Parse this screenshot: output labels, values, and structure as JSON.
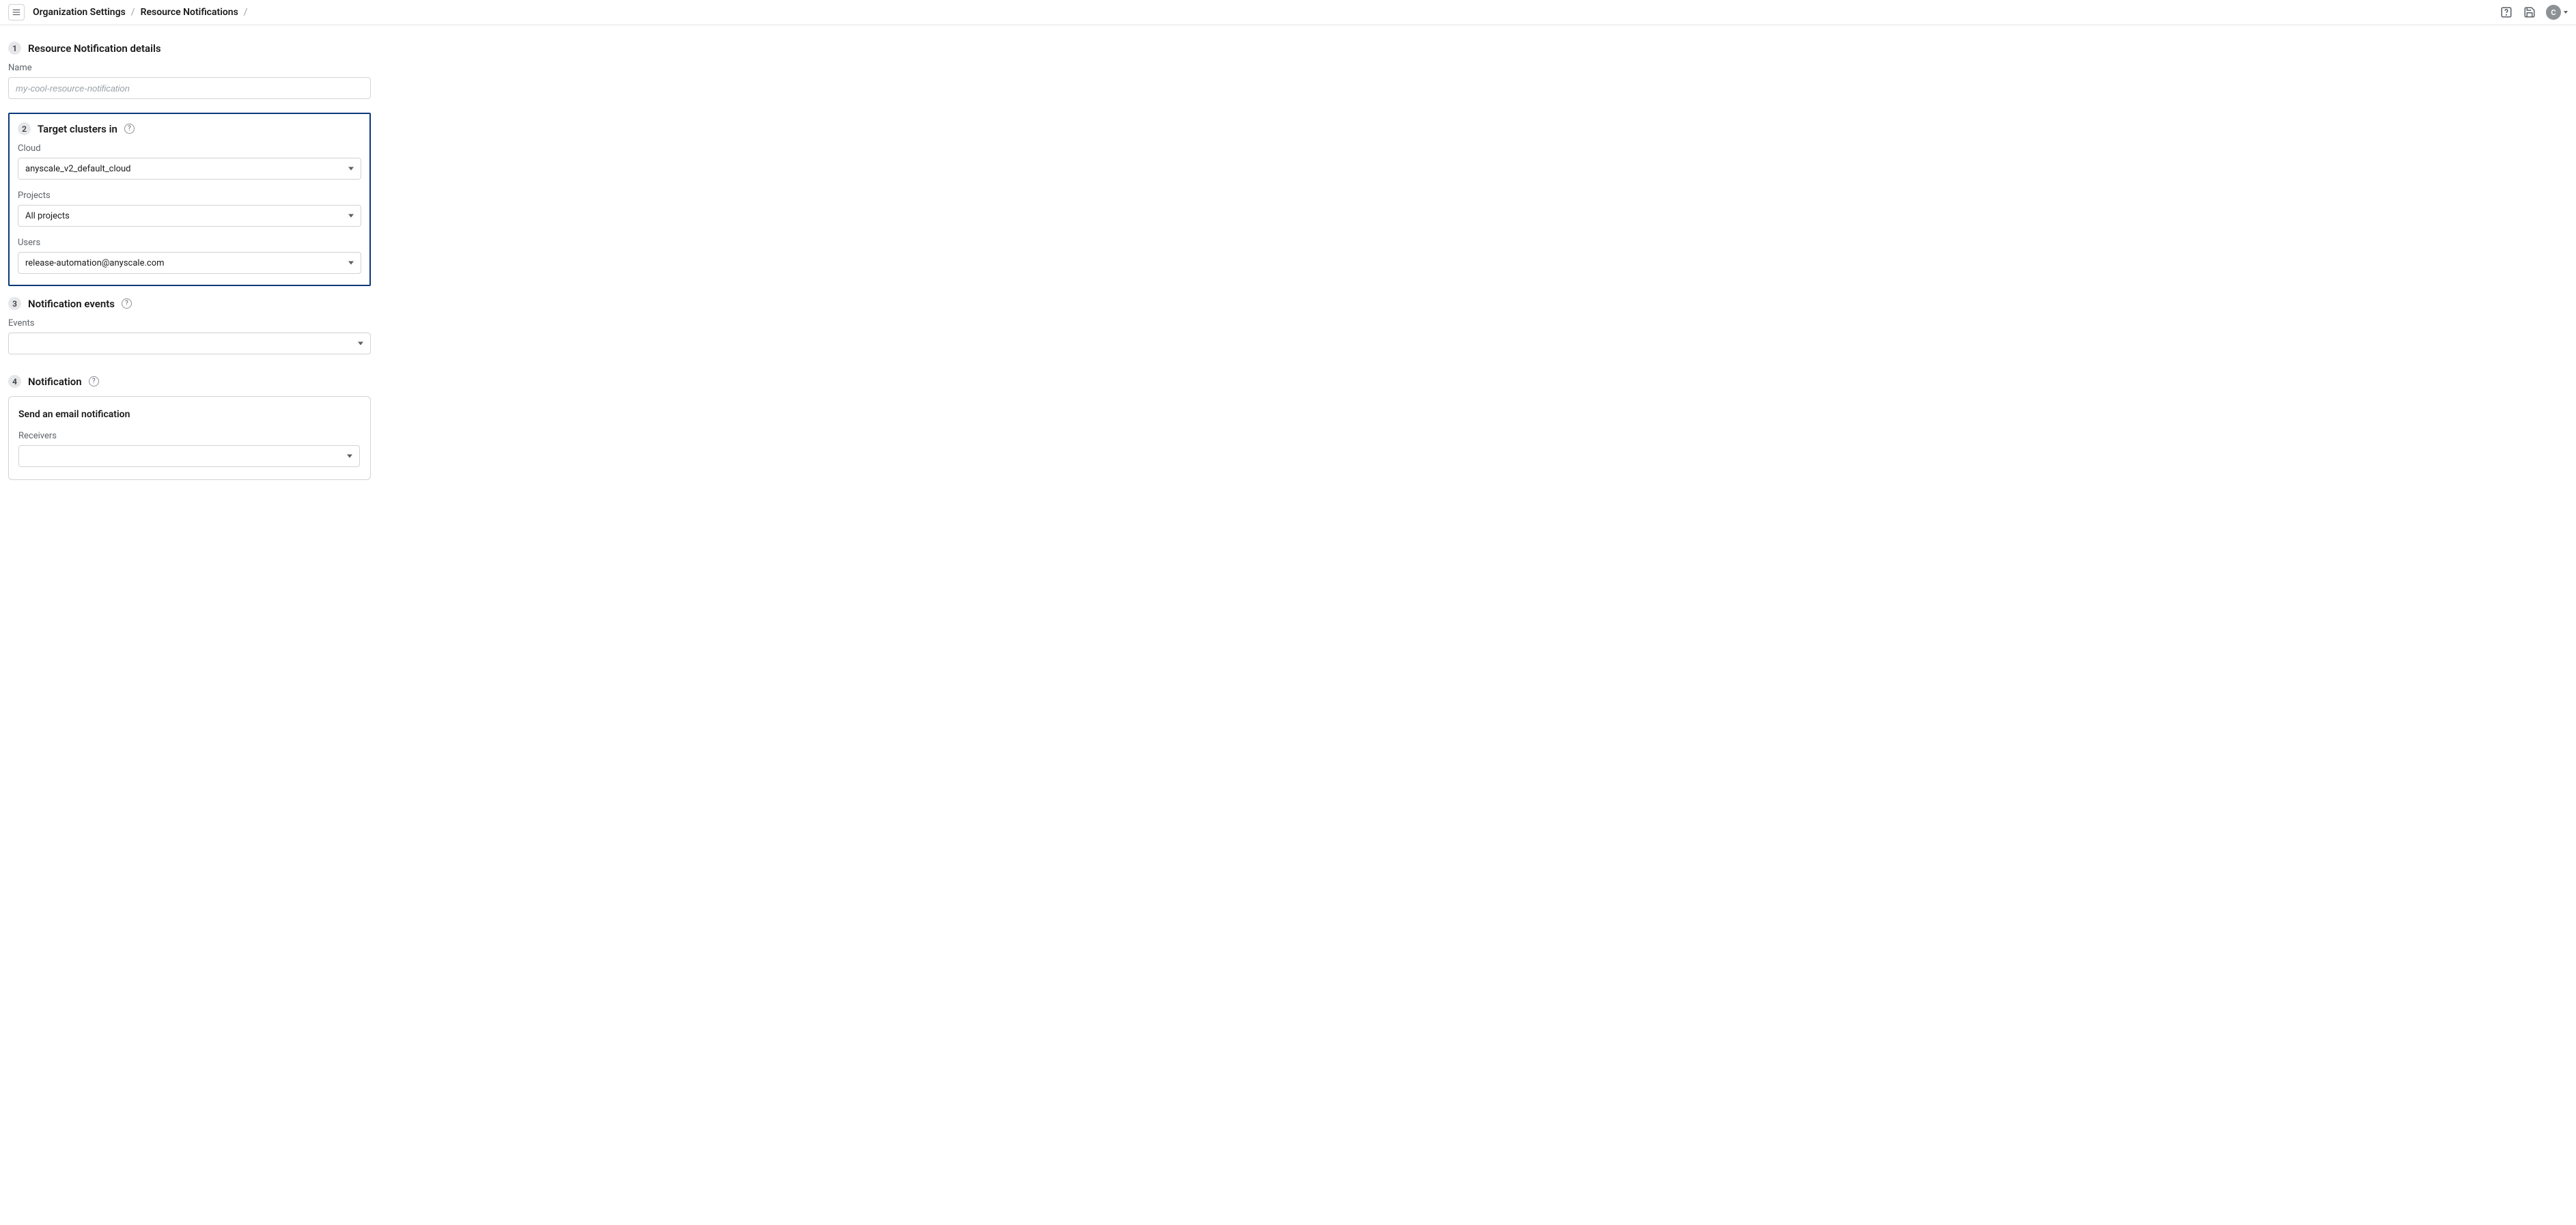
{
  "header": {
    "breadcrumb": {
      "org_settings": "Organization Settings",
      "resource_notifications": "Resource Notifications"
    },
    "avatar_initial": "C"
  },
  "sections": {
    "one": {
      "number": "1",
      "title": "Resource Notification details",
      "name_label": "Name",
      "name_placeholder": "my-cool-resource-notification",
      "name_value": ""
    },
    "two": {
      "number": "2",
      "title": "Target clusters in",
      "cloud_label": "Cloud",
      "cloud_value": "anyscale_v2_default_cloud",
      "projects_label": "Projects",
      "projects_value": "All projects",
      "users_label": "Users",
      "users_value": "release-automation@anyscale.com"
    },
    "three": {
      "number": "3",
      "title": "Notification events",
      "events_label": "Events",
      "events_value": ""
    },
    "four": {
      "number": "4",
      "title": "Notification",
      "card_title": "Send an email notification",
      "receivers_label": "Receivers",
      "receivers_value": ""
    }
  }
}
